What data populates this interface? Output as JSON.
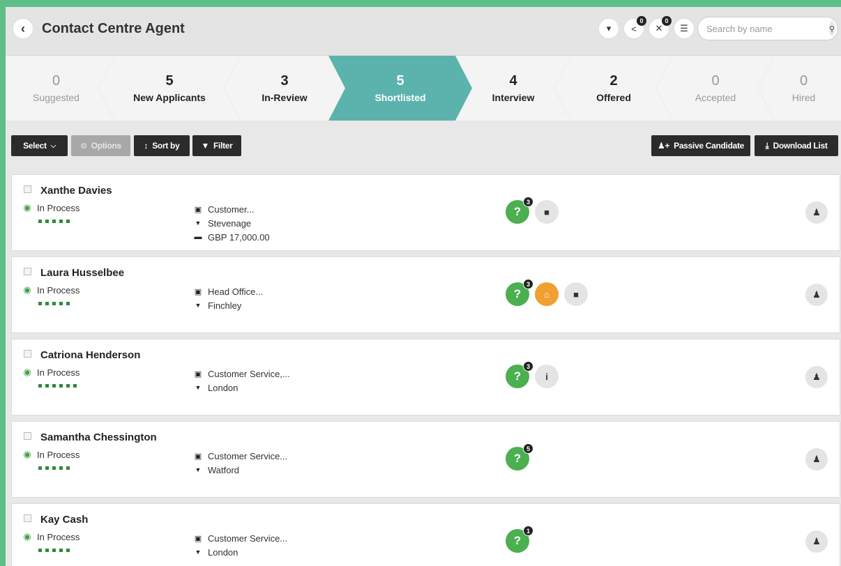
{
  "header": {
    "title": "Contact Centre Agent",
    "back_icon": "‹",
    "icons": [
      {
        "name": "dropdown-icon",
        "glyph": "▾",
        "badge": ""
      },
      {
        "name": "share-icon",
        "glyph": "<",
        "badge": "0"
      },
      {
        "name": "user-block-icon",
        "glyph": "✕",
        "badge": "0"
      },
      {
        "name": "list-icon",
        "glyph": "☰",
        "badge": ""
      }
    ],
    "search_placeholder": "Search by name"
  },
  "pipeline": [
    {
      "count": "0",
      "label": "Suggested",
      "style": "muted",
      "width": 145
    },
    {
      "count": "5",
      "label": "New Applicants",
      "style": "strong",
      "width": 180
    },
    {
      "count": "3",
      "label": "In-Review",
      "style": "strong",
      "width": 150
    },
    {
      "count": "5",
      "label": "Shortlisted",
      "style": "active",
      "width": 182
    },
    {
      "count": "4",
      "label": "Interview",
      "style": "strong",
      "width": 142
    },
    {
      "count": "2",
      "label": "Offered",
      "style": "strong",
      "width": 146
    },
    {
      "count": "0",
      "label": "Accepted",
      "style": "muted",
      "width": 146
    },
    {
      "count": "0",
      "label": "Hired",
      "style": "muted",
      "width": 107
    }
  ],
  "toolbar": {
    "select_label": "Select",
    "options_label": "Options",
    "sort_label": "Sort by",
    "filter_label": "Filter",
    "passive_label": "Passive Candidate",
    "download_label": "Download List"
  },
  "candidates": [
    {
      "name": "Xanthe Davies",
      "status": "In Process",
      "rating": 5,
      "details": [
        {
          "icon": "briefcase-icon",
          "text": "Customer..."
        },
        {
          "icon": "location-icon",
          "text": "Stevenage"
        },
        {
          "icon": "salary-icon",
          "text": "GBP 17,000.00"
        }
      ],
      "q_badge": "3",
      "extra_icons": [
        {
          "name": "note-icon",
          "glyph": "■",
          "style": "grey"
        }
      ]
    },
    {
      "name": "Laura Husselbee",
      "status": "In Process",
      "rating": 5,
      "details": [
        {
          "icon": "briefcase-icon",
          "text": "Head Office..."
        },
        {
          "icon": "location-icon",
          "text": "Finchley"
        }
      ],
      "q_badge": "3",
      "extra_icons": [
        {
          "name": "home-icon",
          "glyph": "⌂",
          "style": "orange"
        },
        {
          "name": "note-icon",
          "glyph": "■",
          "style": "grey"
        }
      ]
    },
    {
      "name": "Catriona Henderson",
      "status": "In Process",
      "rating": 6,
      "details": [
        {
          "icon": "briefcase-icon",
          "text": "Customer Service,..."
        },
        {
          "icon": "location-icon",
          "text": "London"
        }
      ],
      "q_badge": "3",
      "extra_icons": [
        {
          "name": "info-icon",
          "glyph": "i",
          "style": "grey"
        }
      ]
    },
    {
      "name": "Samantha Chessington",
      "status": "In Process",
      "rating": 5,
      "details": [
        {
          "icon": "briefcase-icon",
          "text": "Customer Service..."
        },
        {
          "icon": "location-icon",
          "text": "Watford"
        }
      ],
      "q_badge": "5",
      "extra_icons": []
    },
    {
      "name": "Kay Cash",
      "status": "In Process",
      "rating": 5,
      "details": [
        {
          "icon": "briefcase-icon",
          "text": "Customer Service..."
        },
        {
          "icon": "location-icon",
          "text": "London"
        }
      ],
      "q_badge": "1",
      "extra_icons": []
    }
  ]
}
